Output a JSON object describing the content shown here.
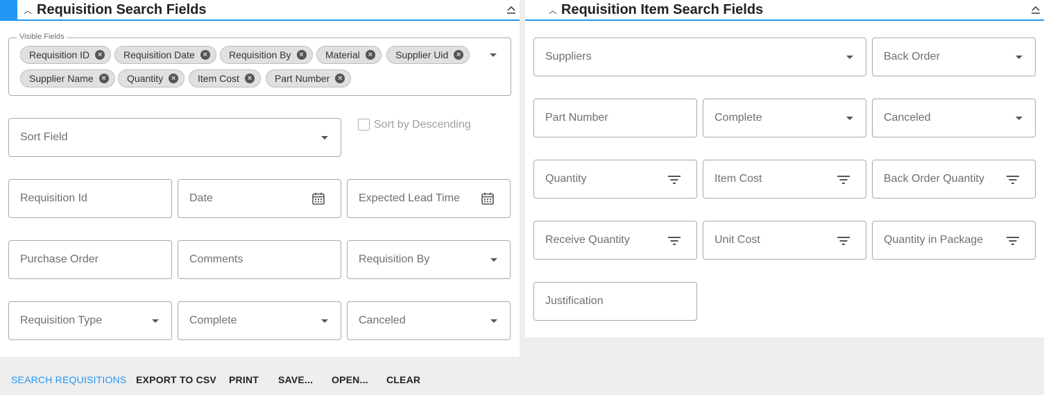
{
  "left_panel": {
    "title": "Requisition Search Fields",
    "visible_fields": {
      "legend": "Visible Fields",
      "chips": [
        "Requisition ID",
        "Requisition Date",
        "Requisition By",
        "Material",
        "Supplier Uid",
        "Supplier Name",
        "Quantity",
        "Item Cost",
        "Part Number"
      ]
    },
    "sort_field": "Sort Field",
    "sort_desc_label": "Sort by Descending",
    "fields": {
      "requisition_id": "Requisition Id",
      "date": "Date",
      "expected_lead_time": "Expected Lead Time",
      "purchase_order": "Purchase Order",
      "comments": "Comments",
      "requisition_by": "Requisition By",
      "requisition_type": "Requisition Type",
      "complete": "Complete",
      "canceled": "Canceled"
    }
  },
  "right_panel": {
    "title": "Requisition Item Search Fields",
    "fields": {
      "suppliers": "Suppliers",
      "back_order": "Back Order",
      "part_number": "Part Number",
      "complete": "Complete",
      "canceled": "Canceled",
      "quantity": "Quantity",
      "item_cost": "Item Cost",
      "back_order_quantity": "Back Order Quantity",
      "receive_quantity": "Receive Quantity",
      "unit_cost": "Unit Cost",
      "quantity_in_package": "Quantity in Package",
      "justification": "Justification"
    }
  },
  "actions": {
    "search": "SEARCH REQUISITIONS",
    "export": "EXPORT TO CSV",
    "print": "PRINT",
    "save": "SAVE...",
    "open": "OPEN...",
    "clear": "CLEAR"
  },
  "colors": {
    "accent": "#2196f3",
    "background": "#eeeeee"
  }
}
